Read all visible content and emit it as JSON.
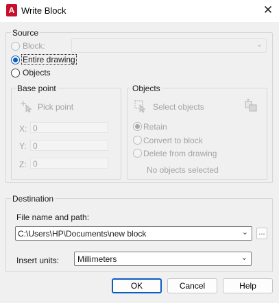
{
  "window": {
    "title": "Write Block",
    "app_icon_letter": "A"
  },
  "source": {
    "legend": "Source",
    "block_label": "Block:",
    "entire_drawing_label": "Entire drawing",
    "objects_label": "Objects",
    "block_selected": false,
    "entire_drawing_selected": true,
    "objects_selected": false
  },
  "base_point": {
    "legend": "Base point",
    "pick_point_label": "Pick point",
    "x_label": "X:",
    "x_value": "0",
    "y_label": "Y:",
    "y_value": "0",
    "z_label": "Z:",
    "z_value": "0"
  },
  "objects": {
    "legend": "Objects",
    "select_objects_label": "Select objects",
    "retain_label": "Retain",
    "convert_label": "Convert to block",
    "delete_label": "Delete from drawing",
    "retain_selected": true,
    "status": "No objects selected"
  },
  "destination": {
    "legend": "Destination",
    "file_label": "File name and path:",
    "file_value": "C:\\Users\\HP\\Documents\\new block",
    "browse_label": "...",
    "units_label": "Insert units:",
    "units_value": "Millimeters"
  },
  "buttons": {
    "ok": "OK",
    "cancel": "Cancel",
    "help": "Help"
  },
  "colors": {
    "accent": "#0a5cc2",
    "app_icon": "#c8102e"
  }
}
